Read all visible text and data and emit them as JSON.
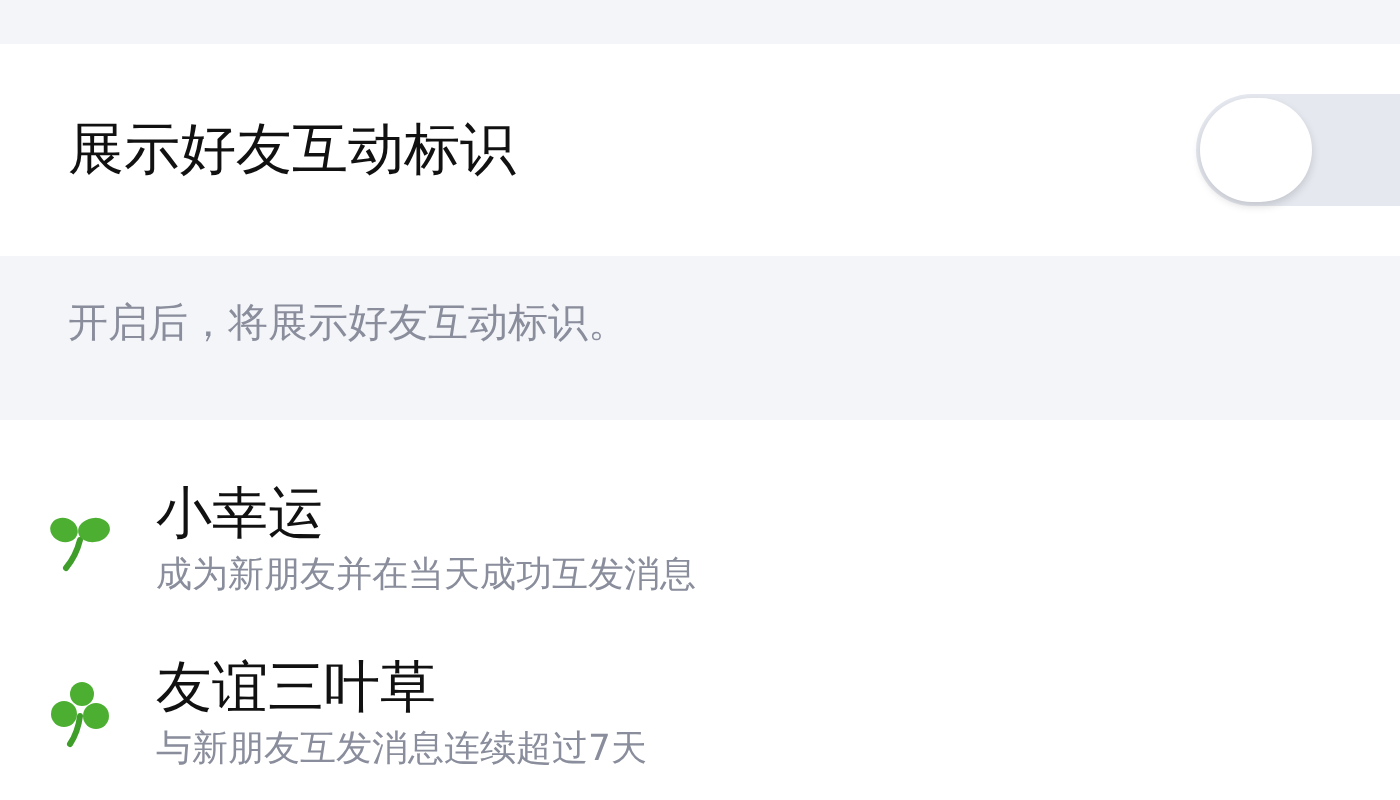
{
  "setting": {
    "label": "展示好友互动标识",
    "on": false
  },
  "hint": "开启后，将展示好友互动标识。",
  "badges": [
    {
      "kind": "sprout",
      "title": "小幸运",
      "description": "成为新朋友并在当天成功互发消息"
    },
    {
      "kind": "clover",
      "title": "友谊三叶草",
      "description": "与新朋友互发消息连续超过7天"
    }
  ]
}
